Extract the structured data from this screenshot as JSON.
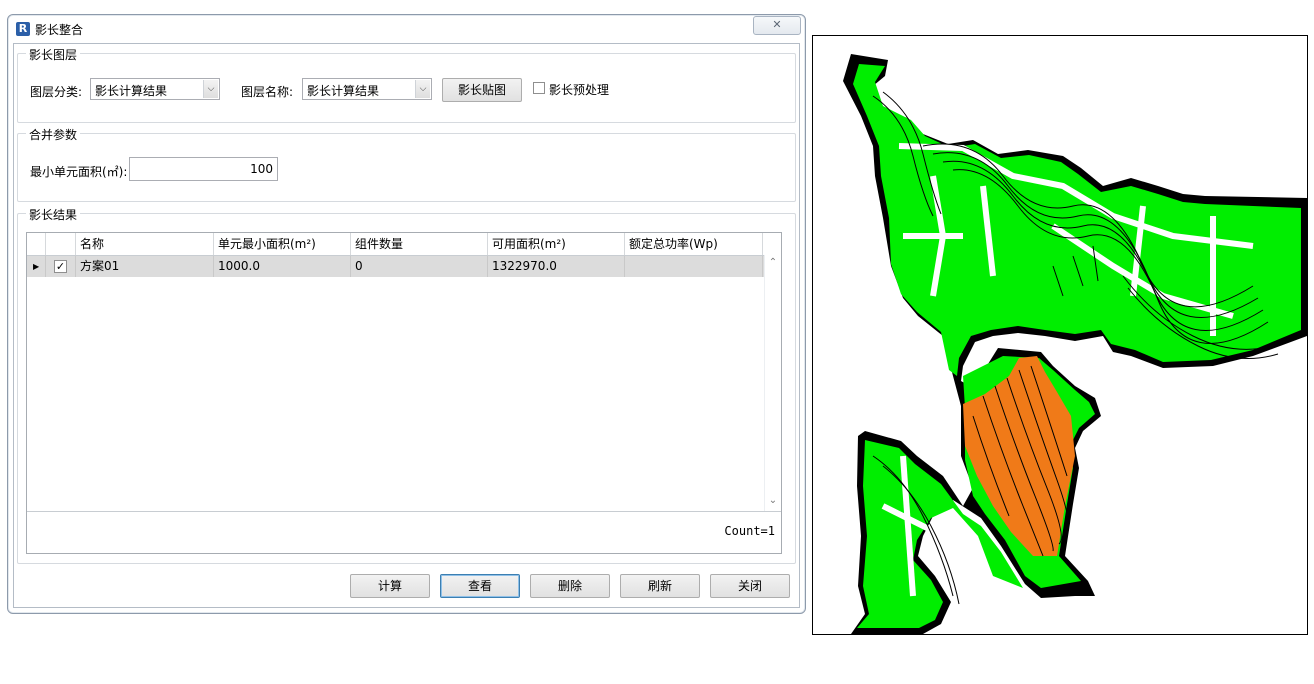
{
  "window": {
    "title": "影长整合",
    "app_icon_letter": "R",
    "close_glyph": "✕"
  },
  "layer_group": {
    "legend": "影长图层",
    "category_label": "图层分类:",
    "category_value": "影长计算结果",
    "layer_name_label": "图层名称:",
    "layer_name_value": "影长计算结果",
    "map_button": "影长贴图",
    "preprocess_label": "影长预处理",
    "preprocess_checked": false
  },
  "merge_group": {
    "legend": "合并参数",
    "min_area_label": "最小单元面积(㎡):",
    "min_area_value": "100"
  },
  "result_group": {
    "legend": "影长结果",
    "columns": [
      "名称",
      "单元最小面积(m²)",
      "组件数量",
      "可用面积(m²)",
      "额定总功率(Wp)"
    ],
    "rows": [
      {
        "name": "方案01",
        "min_area": "1000.0",
        "components": "0",
        "usable_area": "1322970.0",
        "rated_power": "",
        "checked": true
      }
    ],
    "count_text": "Count=1"
  },
  "buttons": {
    "calculate": "计算",
    "view": "查看",
    "delete": "删除",
    "refresh": "刷新",
    "close": "关闭"
  },
  "colors": {
    "land": "#00ee00",
    "shadow_zone": "#f07a18",
    "outline": "#000000"
  }
}
